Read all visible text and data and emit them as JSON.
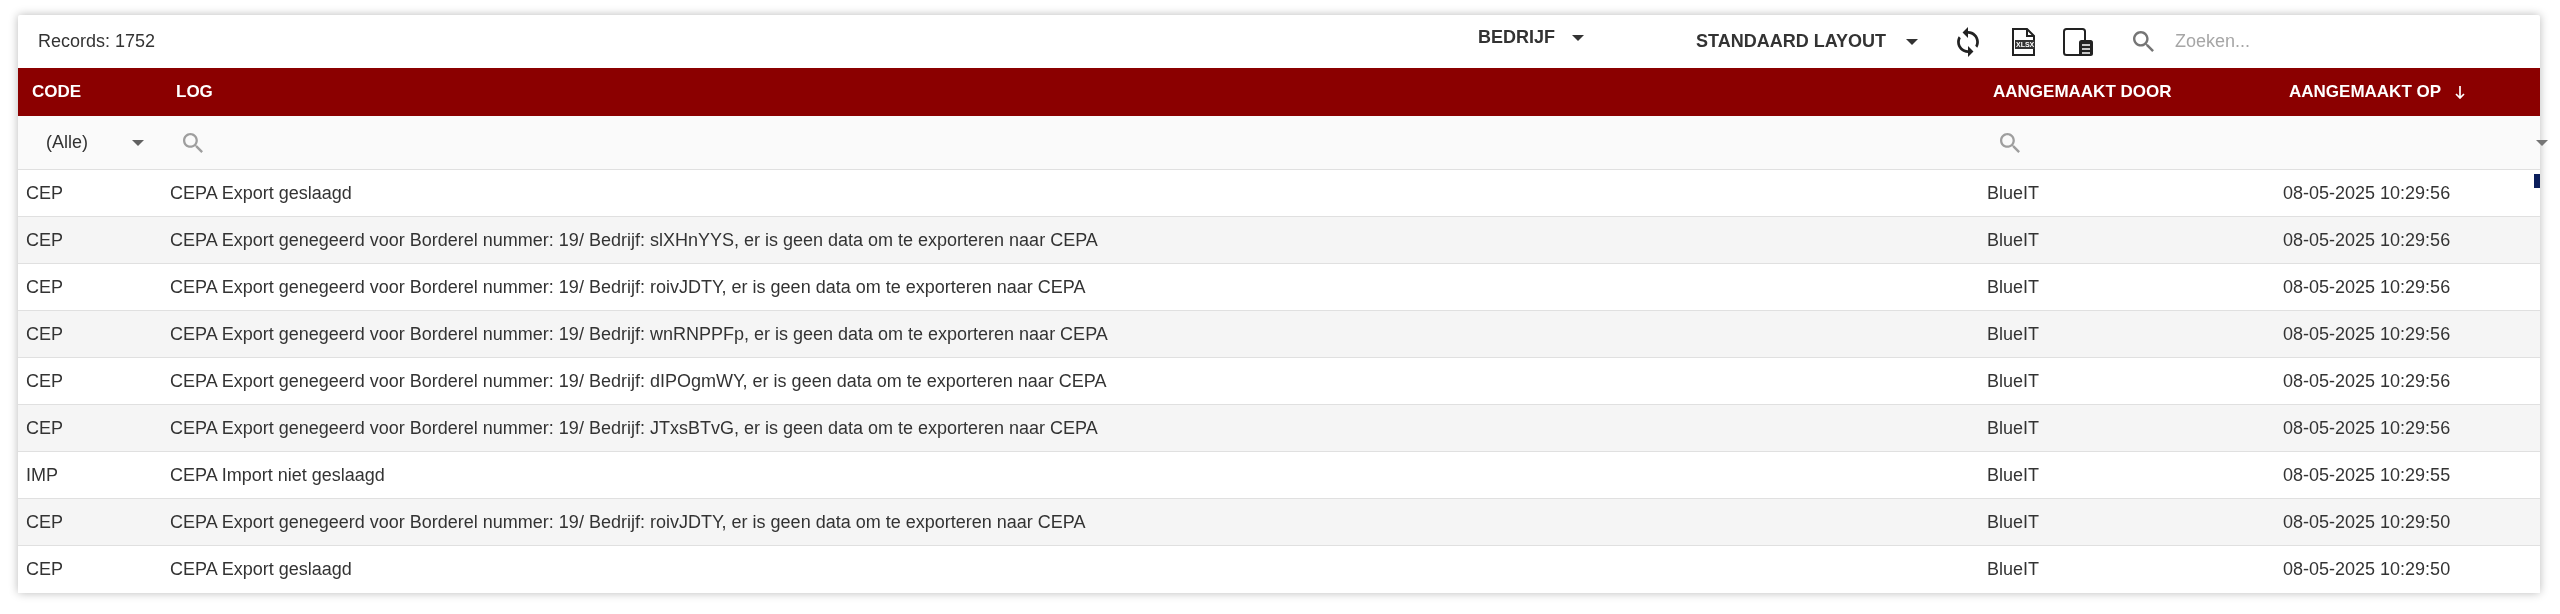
{
  "toolbar": {
    "records": "Records: 1752",
    "company_dropdown": "BEDRIJF",
    "layout_dropdown": "STANDAARD LAYOUT",
    "export_label": "XLSX",
    "search": {
      "placeholder": "Zoeken..."
    }
  },
  "table": {
    "columns": [
      {
        "label": "CODE",
        "sorted_descending": false,
        "filter": {
          "kind": "select",
          "value": "(Alle)"
        }
      },
      {
        "label": "LOG",
        "sorted_descending": false,
        "filter": {
          "kind": "search"
        }
      },
      {
        "label": "AANGEMAAKT DOOR",
        "sorted_descending": false,
        "filter": {
          "kind": "search"
        }
      },
      {
        "label": "AANGEMAAKT OP",
        "sorted_descending": true,
        "filter": {
          "kind": "searchmenu"
        }
      }
    ],
    "rows": [
      {
        "code": "CEP",
        "log": "CEPA Export geslaagd",
        "created_by": "BlueIT",
        "created_at": "08-05-2025 10:29:56"
      },
      {
        "code": "CEP",
        "log": "CEPA Export genegeerd voor Borderel nummer: 19/ Bedrijf: slXHnYYS, er is geen data om te exporteren naar CEPA",
        "created_by": "BlueIT",
        "created_at": "08-05-2025 10:29:56"
      },
      {
        "code": "CEP",
        "log": "CEPA Export genegeerd voor Borderel nummer: 19/ Bedrijf: roivJDTY, er is geen data om te exporteren naar CEPA",
        "created_by": "BlueIT",
        "created_at": "08-05-2025 10:29:56"
      },
      {
        "code": "CEP",
        "log": "CEPA Export genegeerd voor Borderel nummer: 19/ Bedrijf: wnRNPPFp, er is geen data om te exporteren naar CEPA",
        "created_by": "BlueIT",
        "created_at": "08-05-2025 10:29:56"
      },
      {
        "code": "CEP",
        "log": "CEPA Export genegeerd voor Borderel nummer: 19/ Bedrijf: dIPOgmWY, er is geen data om te exporteren naar CEPA",
        "created_by": "BlueIT",
        "created_at": "08-05-2025 10:29:56"
      },
      {
        "code": "CEP",
        "log": "CEPA Export genegeerd voor Borderel nummer: 19/ Bedrijf: JTxsBTvG, er is geen data om te exporteren naar CEPA",
        "created_by": "BlueIT",
        "created_at": "08-05-2025 10:29:56"
      },
      {
        "code": "IMP",
        "log": "CEPA Import niet geslaagd",
        "created_by": "BlueIT",
        "created_at": "08-05-2025 10:29:55"
      },
      {
        "code": "CEP",
        "log": "CEPA Export genegeerd voor Borderel nummer: 19/ Bedrijf: roivJDTY, er is geen data om te exporteren naar CEPA",
        "created_by": "BlueIT",
        "created_at": "08-05-2025 10:29:50"
      },
      {
        "code": "CEP",
        "log": "CEPA Export geslaagd",
        "created_by": "BlueIT",
        "created_at": "08-05-2025 10:29:50"
      }
    ]
  }
}
